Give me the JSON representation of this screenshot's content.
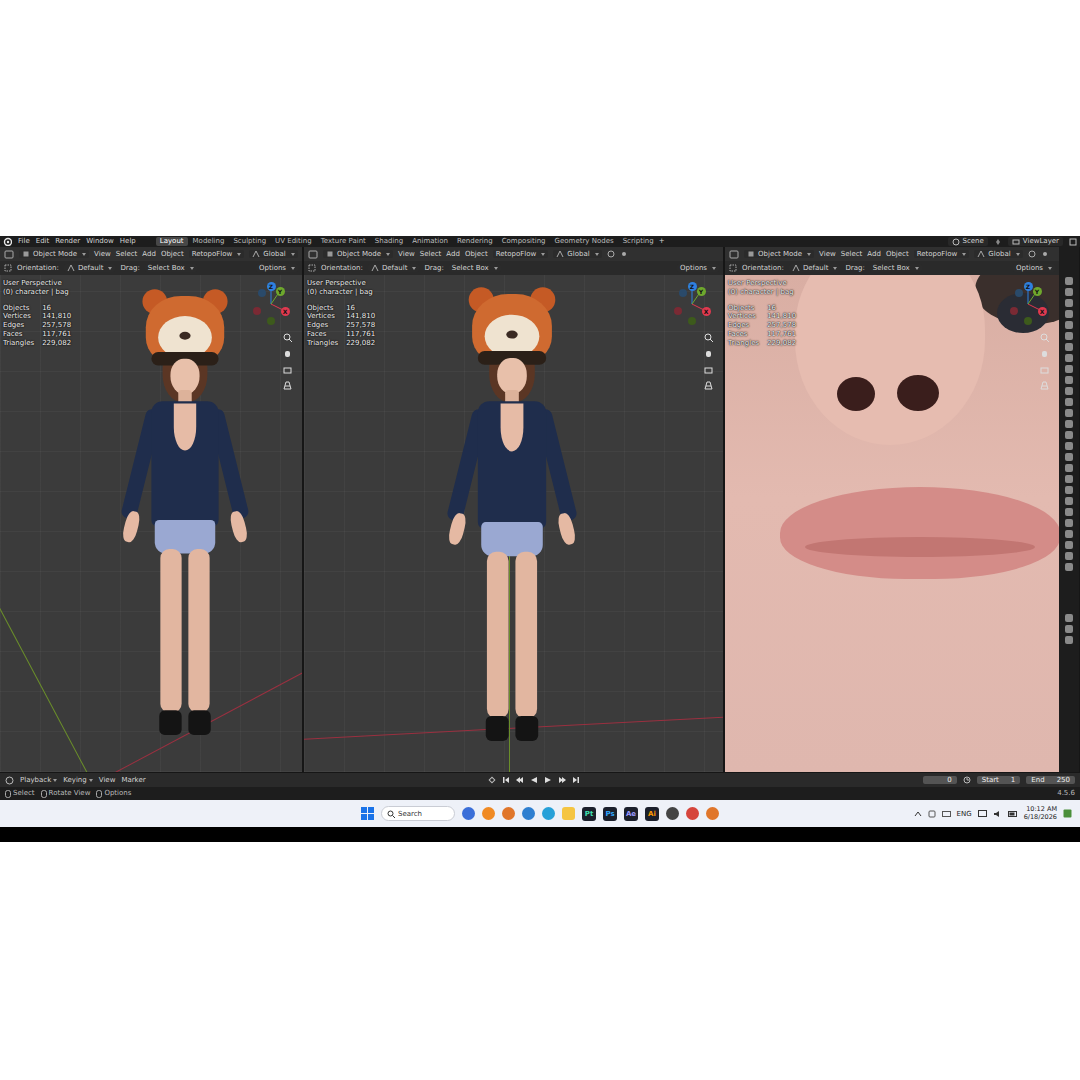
{
  "topbar": {
    "menu": [
      "File",
      "Edit",
      "Render",
      "Window",
      "Help"
    ],
    "workspaces": [
      {
        "label": "Layout",
        "selected": true
      },
      {
        "label": "Modeling",
        "selected": false
      },
      {
        "label": "Sculpting",
        "selected": false
      },
      {
        "label": "UV Editing",
        "selected": false
      },
      {
        "label": "Texture Paint",
        "selected": false
      },
      {
        "label": "Shading",
        "selected": false
      },
      {
        "label": "Animation",
        "selected": false
      },
      {
        "label": "Rendering",
        "selected": false
      },
      {
        "label": "Compositing",
        "selected": false
      },
      {
        "label": "Geometry Nodes",
        "selected": false
      },
      {
        "label": "Scripting",
        "selected": false
      }
    ],
    "add_workspace": "+",
    "scene": "Scene",
    "view_layer": "ViewLayer"
  },
  "viewports": [
    {
      "mode": "Object Mode",
      "menu": [
        "View",
        "Select",
        "Add",
        "Object"
      ],
      "addon": "RetopoFlow",
      "transform": "Global",
      "orientation_label": "Orientation:",
      "orientation": "Default",
      "drag_label": "Drag:",
      "drag": "Select Box",
      "options": "Options",
      "overlay": {
        "view": "User Perspective",
        "collection": "(0) character | bag",
        "stats": [
          {
            "label": "Objects",
            "value": "16"
          },
          {
            "label": "Vertices",
            "value": "141,810"
          },
          {
            "label": "Edges",
            "value": "257,578"
          },
          {
            "label": "Faces",
            "value": "117,761"
          },
          {
            "label": "Triangles",
            "value": "229,082"
          }
        ]
      }
    },
    {
      "mode": "Object Mode",
      "menu": [
        "View",
        "Select",
        "Add",
        "Object"
      ],
      "addon": "RetopoFlow",
      "transform": "Global",
      "orientation_label": "Orientation:",
      "orientation": "Default",
      "drag_label": "Drag:",
      "drag": "Select Box",
      "options": "Options",
      "overlay": {
        "view": "User Perspective",
        "collection": "(0) character | bag",
        "stats": [
          {
            "label": "Objects",
            "value": "16"
          },
          {
            "label": "Vertices",
            "value": "141,810"
          },
          {
            "label": "Edges",
            "value": "257,578"
          },
          {
            "label": "Faces",
            "value": "117,761"
          },
          {
            "label": "Triangles",
            "value": "229,082"
          }
        ]
      }
    },
    {
      "mode": "Object Mode",
      "menu": [
        "View",
        "Select",
        "Add",
        "Object"
      ],
      "addon": "RetopoFlow",
      "transform": "Global",
      "orientation_label": "Orientation:",
      "orientation": "Default",
      "drag_label": "Drag:",
      "drag": "Select Box",
      "options": "Options",
      "overlay": {
        "view": "User Perspective",
        "collection": "(0) character | bag",
        "stats": [
          {
            "label": "Objects",
            "value": "16"
          },
          {
            "label": "Vertices",
            "value": "141,810"
          },
          {
            "label": "Edges",
            "value": "257,578"
          },
          {
            "label": "Faces",
            "value": "117,761"
          },
          {
            "label": "Triangles",
            "value": "229,082"
          }
        ]
      }
    }
  ],
  "gizmo": [
    {
      "label": "Z",
      "color": "#2f80e0"
    },
    {
      "label": "Y",
      "color": "#6fa82d"
    },
    {
      "label": "X",
      "color": "#e0394f"
    }
  ],
  "timeline": {
    "menu": [
      "Playback",
      "Keying",
      "View",
      "Marker"
    ],
    "current_frame": "0",
    "start_label": "Start",
    "start": "1",
    "end_label": "End",
    "end": "250"
  },
  "status_bar": {
    "hints": [
      "Select",
      "Rotate View",
      "Options"
    ],
    "version": "4.5.6"
  },
  "taskbar": {
    "search": {
      "placeholder": "Search"
    },
    "apps": [
      {
        "label": "Pt",
        "color": "#3fe0b0"
      },
      {
        "label": "Ps",
        "color": "#31a8ff"
      },
      {
        "label": "Ae",
        "color": "#9999ff"
      },
      {
        "label": "Ai",
        "color": "#ff9a00"
      }
    ],
    "language": "ENG",
    "time": "10:12 AM",
    "date": "6/18/2026"
  }
}
